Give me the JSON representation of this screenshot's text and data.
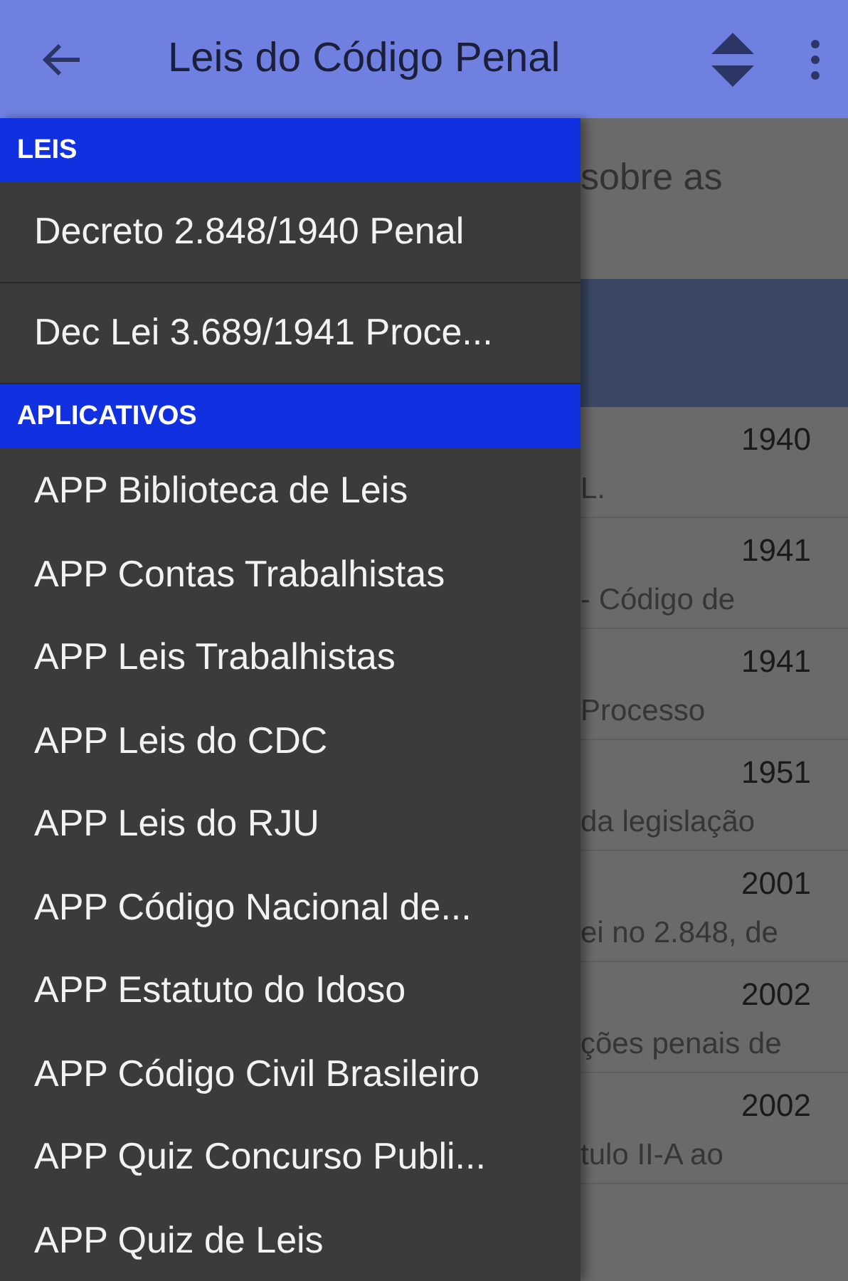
{
  "app_bar": {
    "title": "Leis do Código Penal"
  },
  "background": {
    "intro": "sobre as",
    "rows": [
      {
        "year": "1940",
        "text": "L."
      },
      {
        "year": "1941",
        "text": "- Código de"
      },
      {
        "year": "1941",
        "text": "Processo"
      },
      {
        "year": "1951",
        "text": "da legislação"
      },
      {
        "year": "2001",
        "text": "ei no 2.848, de"
      },
      {
        "year": "2002",
        "text": "ções penais de"
      },
      {
        "year": "2002",
        "text": "tulo II-A ao"
      }
    ]
  },
  "drawer": {
    "sections": [
      {
        "title": "LEIS",
        "kind": "divided",
        "items": [
          "Decreto 2.848/1940 Penal",
          "Dec Lei 3.689/1941 Proce..."
        ]
      },
      {
        "title": "APLICATIVOS",
        "kind": "plain",
        "items": [
          "APP Biblioteca de Leis",
          "APP Contas Trabalhistas",
          "APP Leis Trabalhistas",
          "APP Leis do CDC",
          "APP Leis do RJU",
          "APP Código Nacional de...",
          "APP Estatuto do Idoso",
          "APP Código Civil Brasileiro",
          "APP Quiz Concurso Publi...",
          "APP Quiz de Leis"
        ]
      }
    ]
  }
}
